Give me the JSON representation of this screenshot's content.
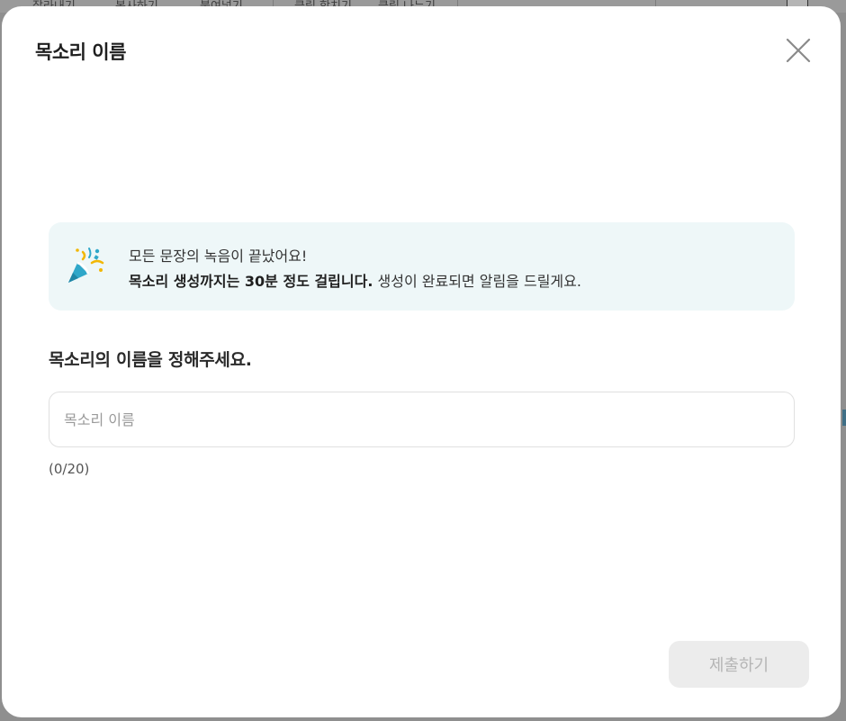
{
  "background": {
    "toolbar_items": [
      "잘라내기",
      "복사하기",
      "붙여넣기",
      "클립 합치기",
      "클립 나누기"
    ]
  },
  "modal": {
    "title": "목소리 이름",
    "close_icon": "close-icon",
    "info": {
      "icon": "party-popper-icon",
      "line1": "모든 문장의 녹음이 끝났어요!",
      "line2_bold": "목소리 생성까지는 30분 정도 걸립니다.",
      "line2_regular": " 생성이 완료되면 알림을 드릴게요."
    },
    "field_label": "목소리의 이름을 정해주세요.",
    "input": {
      "value": "",
      "placeholder": "목소리 이름"
    },
    "char_count": "(0/20)",
    "submit_label": "제출하기"
  },
  "colors": {
    "info_bg": "#eef7f8",
    "submit_disabled_bg": "#ececec",
    "submit_disabled_text": "#b5b5b5"
  }
}
